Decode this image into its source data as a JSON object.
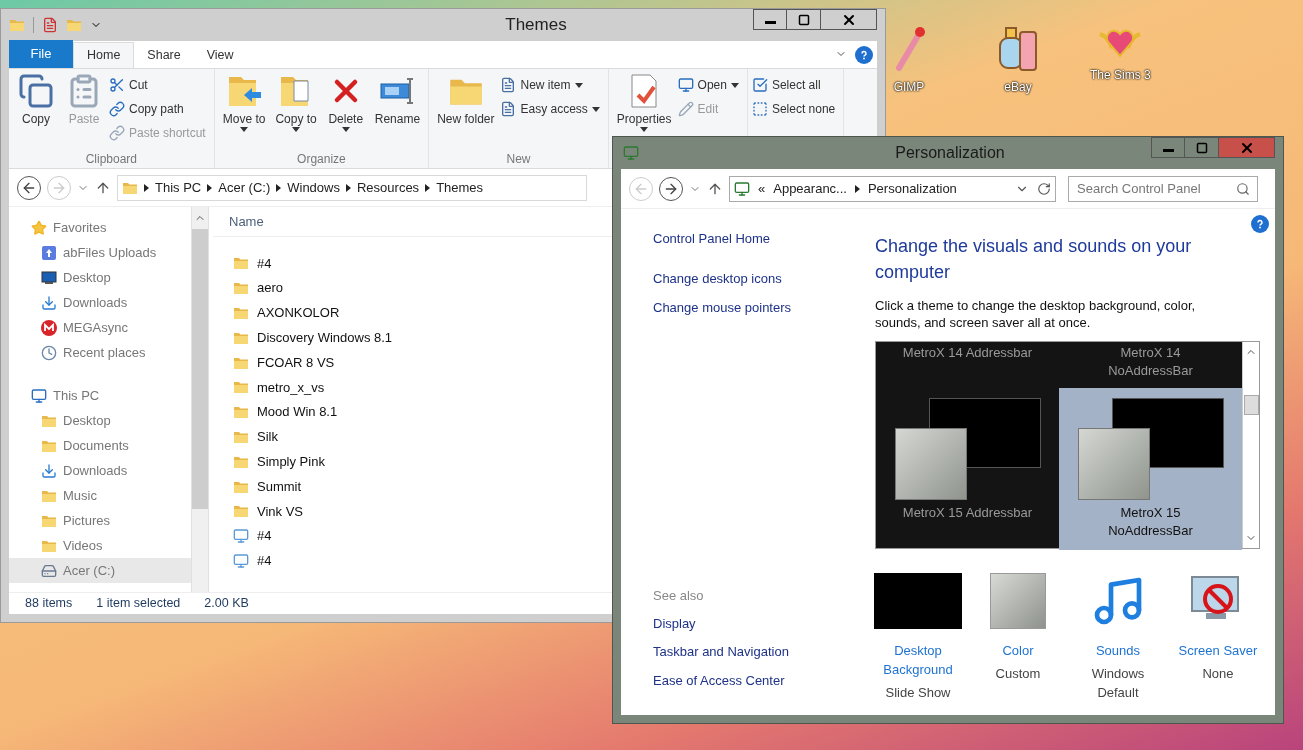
{
  "desktop_icons": [
    {
      "label": "GIMP",
      "kind": "wand"
    },
    {
      "label": "eBay",
      "kind": "bottles"
    },
    {
      "label": "The Sims 3",
      "kind": "heart"
    }
  ],
  "explorer": {
    "title": "Themes",
    "tabs": [
      {
        "label": "File",
        "kind": "file",
        "selected": false
      },
      {
        "label": "Home",
        "kind": "tab",
        "selected": true
      },
      {
        "label": "Share",
        "kind": "tab",
        "selected": false
      },
      {
        "label": "View",
        "kind": "tab",
        "selected": false
      }
    ],
    "ribbon_groups": [
      {
        "name": "Clipboard",
        "large": [
          {
            "label": "Copy",
            "kind": "copy",
            "menu": false,
            "disabled": false
          },
          {
            "label": "Paste",
            "kind": "paste",
            "menu": false,
            "disabled": true
          }
        ],
        "small": [
          {
            "label": "Cut",
            "kind": "cut",
            "menu": false,
            "disabled": false
          },
          {
            "label": "Copy path",
            "kind": "path",
            "menu": false,
            "disabled": false
          },
          {
            "label": "Paste shortcut",
            "kind": "shortcut",
            "menu": false,
            "disabled": true
          }
        ]
      },
      {
        "name": "Organize",
        "large": [
          {
            "label": "Move to",
            "kind": "move",
            "menu": true,
            "disabled": false
          },
          {
            "label": "Copy to",
            "kind": "copyto",
            "menu": true,
            "disabled": false
          },
          {
            "label": "Delete",
            "kind": "delete",
            "menu": true,
            "disabled": false
          },
          {
            "label": "Rename",
            "kind": "rename",
            "menu": false,
            "disabled": false
          }
        ]
      },
      {
        "name": "New",
        "large": [
          {
            "label": "New folder",
            "kind": "folder",
            "menu": false,
            "disabled": false
          }
        ],
        "small": [
          {
            "label": "New item",
            "kind": "newitem",
            "menu": true,
            "disabled": false
          },
          {
            "label": "Easy access",
            "kind": "easy",
            "menu": true,
            "disabled": false
          }
        ]
      },
      {
        "large": [
          {
            "label": "Properties",
            "kind": "properties",
            "menu": true,
            "disabled": false
          }
        ],
        "small": [
          {
            "label": "Open",
            "kind": "open",
            "menu": true,
            "disabled": false
          },
          {
            "label": "Edit",
            "kind": "edit",
            "menu": false,
            "disabled": true
          }
        ]
      },
      {
        "small": [
          {
            "label": "Select all",
            "kind": "selall",
            "menu": false,
            "disabled": false
          },
          {
            "label": "Select none",
            "kind": "selnone",
            "menu": false,
            "disabled": false
          }
        ]
      }
    ],
    "path": [
      "This PC",
      "Acer (C:)",
      "Windows",
      "Resources",
      "Themes"
    ],
    "nav": [
      {
        "label": "Favorites",
        "kind": "star",
        "selected": false,
        "children": [
          {
            "label": "abFiles Uploads",
            "kind": "upload",
            "selected": false
          },
          {
            "label": "Desktop",
            "kind": "monitor",
            "selected": false
          },
          {
            "label": "Downloads",
            "kind": "download",
            "selected": false
          },
          {
            "label": "MEGAsync",
            "kind": "mega",
            "selected": false
          },
          {
            "label": "Recent places",
            "kind": "recent",
            "selected": false
          }
        ]
      },
      {
        "label": "This PC",
        "kind": "pc",
        "selected": false,
        "children": [
          {
            "label": "Desktop",
            "kind": "folder",
            "selected": false
          },
          {
            "label": "Documents",
            "kind": "folder",
            "selected": false
          },
          {
            "label": "Downloads",
            "kind": "download",
            "selected": false
          },
          {
            "label": "Music",
            "kind": "folder",
            "selected": false
          },
          {
            "label": "Pictures",
            "kind": "folder",
            "selected": false
          },
          {
            "label": "Videos",
            "kind": "folder",
            "selected": false
          },
          {
            "label": "Acer (C:)",
            "kind": "drive",
            "selected": true
          }
        ]
      }
    ],
    "column": "Name",
    "files": [
      {
        "name": "#4",
        "kind": "folder"
      },
      {
        "name": "aero",
        "kind": "folder"
      },
      {
        "name": "AXONKOLOR",
        "kind": "folder"
      },
      {
        "name": "Discovery Windows 8.1",
        "kind": "folder"
      },
      {
        "name": "FCOAR 8 VS",
        "kind": "folder"
      },
      {
        "name": "metro_x_vs",
        "kind": "folder"
      },
      {
        "name": "Mood Win 8.1",
        "kind": "folder"
      },
      {
        "name": "Silk",
        "kind": "folder"
      },
      {
        "name": "Simply Pink",
        "kind": "folder"
      },
      {
        "name": "Summit",
        "kind": "folder"
      },
      {
        "name": "Vink VS",
        "kind": "folder"
      },
      {
        "name": "#4",
        "kind": "theme"
      },
      {
        "name": "#4",
        "kind": "theme"
      }
    ],
    "status": [
      "88 items",
      "1 item selected",
      "2.00 KB"
    ]
  },
  "personalization": {
    "title": "Personalization",
    "crumbs": [
      "«",
      "Appearanc...",
      "Personalization"
    ],
    "search": {
      "placeholder": "Search Control Panel"
    },
    "links": [
      "Control Panel Home",
      "Change desktop icons",
      "Change mouse pointers"
    ],
    "see_also": {
      "heading": "See also",
      "links": [
        "Display",
        "Taskbar and Navigation",
        "Ease of Access Center"
      ]
    },
    "heading": "Change the visuals and sounds on your computer",
    "description": "Click a theme to change the desktop background, color, sounds, and screen saver all at once.",
    "themes": [
      {
        "label": "MetroX 14 Addressbar",
        "kind": "partial",
        "selected": false
      },
      {
        "label": "MetroX 14 NoAddressBar",
        "kind": "partial",
        "selected": false
      },
      {
        "label": "MetroX 15 Addressbar",
        "kind": "full",
        "selected": false
      },
      {
        "label": "MetroX 15 NoAddressBar",
        "kind": "full",
        "selected": true
      }
    ],
    "settings": [
      {
        "label": "Desktop Background",
        "value": "Slide Show",
        "kind": "background"
      },
      {
        "label": "Color",
        "value": "Custom",
        "kind": "color"
      },
      {
        "label": "Sounds",
        "value": "Windows Default",
        "kind": "sounds"
      },
      {
        "label": "Screen Saver",
        "value": "None",
        "kind": "screensaver"
      }
    ]
  }
}
